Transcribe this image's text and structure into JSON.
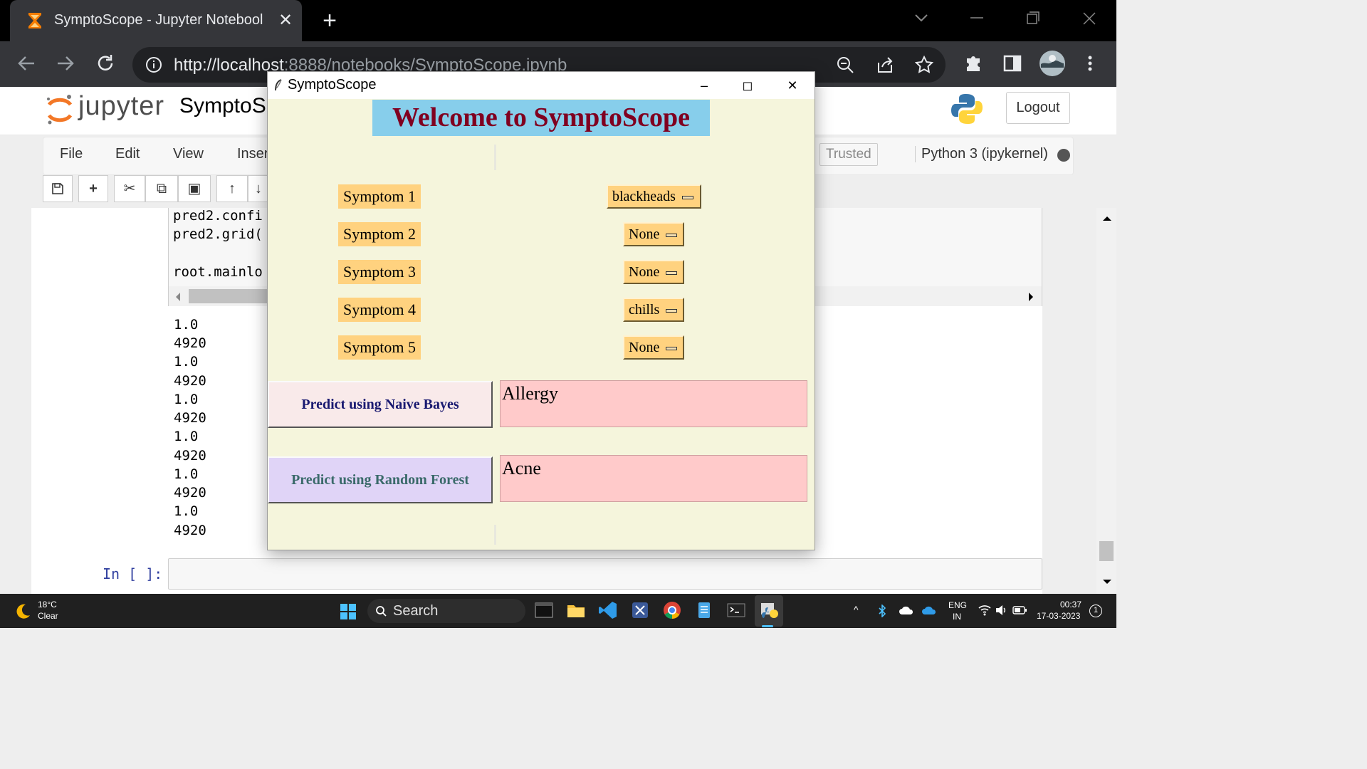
{
  "browser": {
    "tab_title": "SymptoScope - Jupyter Notebool",
    "url_host": "http://localhost",
    "url_path": ":8888/notebooks/SymptoScope.ipynb"
  },
  "jupyter": {
    "logo_text": "jupyter",
    "notebook_name": "SymptoS",
    "logout_label": "Logout",
    "menu": [
      "File",
      "Edit",
      "View",
      "Inser"
    ],
    "trusted_label": "Trusted",
    "kernel_label": "Python 3 (ipykernel)",
    "code_lines": [
      "pred2.confi",
      "pred2.grid(",
      "",
      "root.mainlo"
    ],
    "output_lines": [
      "1.0",
      "4920",
      "1.0",
      "4920",
      "1.0",
      "4920",
      "1.0",
      "4920",
      "1.0",
      "4920",
      "1.0",
      "4920"
    ],
    "input_prompt": "In [ ]:"
  },
  "app": {
    "window_title": "SymptoScope",
    "welcome_text": "Welcome to SymptoScope",
    "symptom_labels": [
      "Symptom 1",
      "Symptom 2",
      "Symptom 3",
      "Symptom 4",
      "Symptom 5"
    ],
    "symptom_values": [
      "blackheads",
      "None",
      "None",
      "chills",
      "None"
    ],
    "nb_button": "Predict using Naive Bayes",
    "rf_button": "Predict using Random Forest",
    "nb_result": "Allergy",
    "rf_result": "Acne",
    "colors": {
      "welcome_bg": "#87ceeb",
      "welcome_fg": "#800020",
      "window_bg": "#f5f5dc",
      "label_bg": "#ffd27f",
      "result_bg": "#ffcaca",
      "nb_btn_bg": "#f9eaea",
      "nb_btn_fg": "#191970",
      "rf_btn_bg": "#e0d4f7",
      "rf_btn_fg": "#3a6a6a"
    }
  },
  "taskbar": {
    "weather_temp": "18°C",
    "weather_cond": "Clear",
    "search_label": "Search",
    "lang_top": "ENG",
    "lang_bottom": "IN",
    "time": "00:37",
    "date": "17-03-2023",
    "notif_count": "1"
  }
}
